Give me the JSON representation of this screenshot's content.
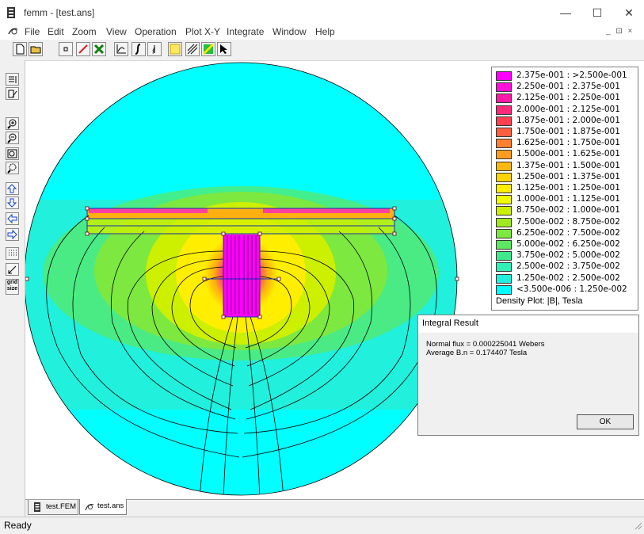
{
  "window": {
    "title": "femm - [test.ans]",
    "controls": {
      "minimize": "—",
      "maximize": "☐",
      "close": "✕"
    }
  },
  "menubar": {
    "items": [
      "File",
      "Edit",
      "Zoom",
      "View",
      "Operation",
      "Plot X-Y",
      "Integrate",
      "Window",
      "Help"
    ],
    "mdi_controls": "_ ⊡ ×"
  },
  "toolbar": {
    "icons": [
      "new-file-icon",
      "open-folder-icon",
      "point-mode-icon",
      "contour-mode-icon",
      "area-mode-icon",
      "plot-xy-icon",
      "integrate-icon",
      "line-integral-icon",
      "grid-icon",
      "contour-plot-icon",
      "density-plot-icon",
      "select-arrow-icon"
    ]
  },
  "left_toolbar": {
    "icons": [
      "show-mesh-icon",
      "edit-icon",
      "zoom-in-icon",
      "zoom-out-icon",
      "zoom-natural-icon",
      "zoom-window-icon",
      "pan-up-icon",
      "pan-down-icon",
      "pan-left-icon",
      "pan-right-icon",
      "show-grid-icon",
      "snap-grid-icon",
      "grid-size-icon"
    ],
    "grid_size_label": "grid size"
  },
  "legend": {
    "entries": [
      {
        "label": "2.375e-001 : >2.500e-001",
        "color": "#ff00ff"
      },
      {
        "label": "2.250e-001 : 2.375e-001",
        "color": "#ff10d8"
      },
      {
        "label": "2.125e-001 : 2.250e-001",
        "color": "#ff1aa8"
      },
      {
        "label": "2.000e-001 : 2.125e-001",
        "color": "#ff2a7a"
      },
      {
        "label": "1.875e-001 : 2.000e-001",
        "color": "#ff4050"
      },
      {
        "label": "1.750e-001 : 1.875e-001",
        "color": "#ff6040"
      },
      {
        "label": "1.625e-001 : 1.750e-001",
        "color": "#ff8030"
      },
      {
        "label": "1.500e-001 : 1.625e-001",
        "color": "#ff9c20"
      },
      {
        "label": "1.375e-001 : 1.500e-001",
        "color": "#ffb810"
      },
      {
        "label": "1.250e-001 : 1.375e-001",
        "color": "#ffd400"
      },
      {
        "label": "1.125e-001 : 1.250e-001",
        "color": "#ffee00"
      },
      {
        "label": "1.000e-001 : 1.125e-001",
        "color": "#f0ff00"
      },
      {
        "label": "8.750e-002 : 1.000e-001",
        "color": "#ccf000"
      },
      {
        "label": "7.500e-002 : 8.750e-002",
        "color": "#a0e820"
      },
      {
        "label": "6.250e-002 : 7.500e-002",
        "color": "#7de840"
      },
      {
        "label": "5.000e-002 : 6.250e-002",
        "color": "#5ce860"
      },
      {
        "label": "3.750e-002 : 5.000e-002",
        "color": "#40e88c"
      },
      {
        "label": "2.500e-002 : 3.750e-002",
        "color": "#30f0b8"
      },
      {
        "label": "1.250e-002 : 2.500e-002",
        "color": "#20f0dc"
      },
      {
        "label": "<3.500e-006 : 1.250e-002",
        "color": "#00ffff"
      }
    ],
    "caption": "Density Plot: |B|, Tesla"
  },
  "dialog": {
    "title": "Integral Result",
    "line1": "Normal flux = 0.000225041 Webers",
    "line2": "Average B.n = 0.174407 Tesla",
    "ok_label": "OK"
  },
  "tabs": [
    {
      "label": "test.FEM",
      "active": false
    },
    {
      "label": "test.ans",
      "active": true
    }
  ],
  "status": "Ready",
  "colors": {
    "background_field": "#00ffff",
    "low_field": "#20f0dc",
    "mid_field": "#5ce860",
    "high_field": "#ffee00",
    "peak_field": "#ff00ff"
  }
}
